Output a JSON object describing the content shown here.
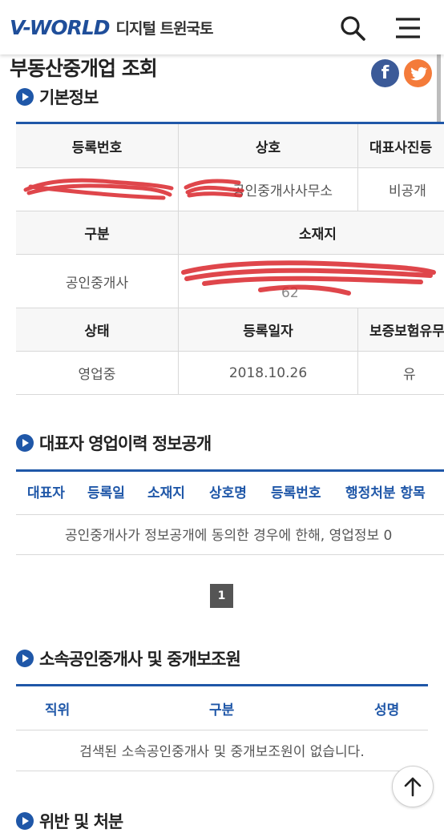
{
  "header": {
    "logo_main": "V-WORLD",
    "logo_sub": "디지털 트윈국토",
    "search_icon": "search-icon",
    "menu_icon": "hamburger-menu-icon"
  },
  "page": {
    "title": "부동산중개업 조회",
    "social": {
      "facebook": "f",
      "twitter": "twitter-icon"
    }
  },
  "basic_info": {
    "section_title": "기본정보",
    "headers_row1": [
      "등록번호",
      "상호",
      "대표사진등"
    ],
    "values_row1": [
      "",
      "공인중개사사무소",
      "비공개"
    ],
    "headers_row2": [
      "구분",
      "소재지"
    ],
    "values_row2": [
      "공인중개사",
      "62"
    ],
    "headers_row3": [
      "상태",
      "등록일자",
      "보증보험유무"
    ],
    "values_row3": [
      "영업중",
      "2018.10.26",
      "유"
    ]
  },
  "history": {
    "section_title": "대표자 영업이력 정보공개",
    "tabs": [
      "대표자",
      "등록일",
      "소재지",
      "상호명",
      "등록번호",
      "행정처분 항목"
    ],
    "notice": "공인중개사가 정보공개에 동의한 경우에 한해, 영업정보 0",
    "page": "1"
  },
  "staff": {
    "section_title": "소속공인중개사 및 중개보조원",
    "columns": [
      "직위",
      "구분",
      "성명"
    ],
    "empty_message": "검색된 소속공인중개사 및 중개보조원이 없습니다."
  },
  "next_section": {
    "title": "위반 및 처분"
  },
  "colors": {
    "accent": "#1f57a8",
    "facebook": "#3b5a98",
    "twitter": "#f47b3a",
    "scribble": "#d9262b"
  }
}
